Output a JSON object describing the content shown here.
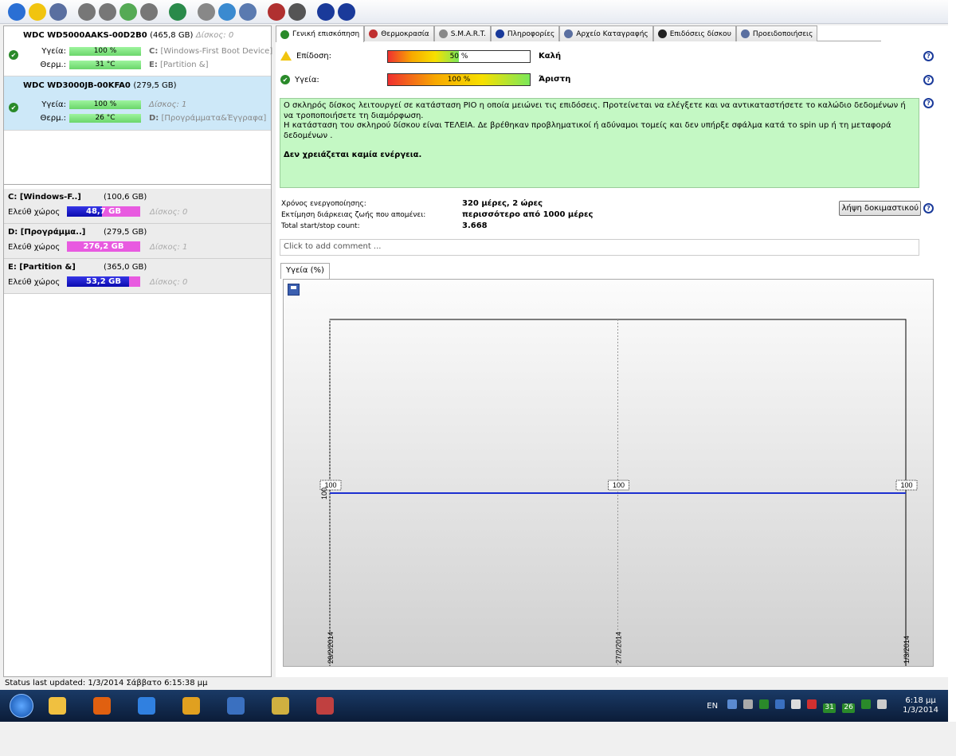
{
  "toolbar": {
    "icons": [
      "refresh-icon",
      "warning-icon",
      "window-icon",
      "disk-icon",
      "disk-icon",
      "disk-icon",
      "disk-icon",
      "globe-icon",
      "document-icon",
      "sync-icon",
      "network-icon",
      "chart-icon",
      "settings-icon",
      "help-icon",
      "info-icon"
    ],
    "icon_colors": [
      "#2a6fd4",
      "#f1c40f",
      "#5a6fa0",
      "#777777",
      "#777777",
      "#55aa55",
      "#777777",
      "#2a8a4a",
      "#888888",
      "#3a8ad0",
      "#5a7ab0",
      "#b03030",
      "#555555",
      "#1a3a9a",
      "#1a3a9a"
    ]
  },
  "disks": [
    {
      "name": "WDC WD5000AAKS-00D2B0",
      "capacity": "(465,8 GB)",
      "index_label": "Δίσκος: 0",
      "health_label": "Υγεία:",
      "health_value": "100 %",
      "health_level": 100,
      "temp_label": "Θερμ.:",
      "temp_value": "31 °C",
      "partitions": [
        {
          "letter": "C:",
          "name": "[Windows-First Boot Device]"
        },
        {
          "letter": "E:",
          "name": "[Partition &]"
        }
      ]
    },
    {
      "name": "WDC WD3000JB-00KFA0",
      "capacity": "(279,5 GB)",
      "health_label": "Υγεία:",
      "health_value": "100 %",
      "health_level": 100,
      "temp_label": "Θερμ.:",
      "temp_value": "26 °C",
      "index_label": "Δίσκος: 1",
      "partitions": [
        {
          "letter": "D:",
          "name": "[Προγράμματα&Έγγραφα]"
        }
      ]
    }
  ],
  "volumes": [
    {
      "name": "C: [Windows-F..]",
      "size": "(100,6 GB)",
      "free_label": "Ελεύθ χώρος",
      "free": "48,7 GB",
      "free_fraction": 0.48,
      "disk": "Δίσκος: 0"
    },
    {
      "name": "D: [Προγράμμα..]",
      "size": "(279,5 GB)",
      "free_label": "Ελεύθ χώρος",
      "free": "276,2 GB",
      "free_fraction": 0.0,
      "disk": "Δίσκος: 1"
    },
    {
      "name": "E: [Partition &]",
      "size": "(365,0 GB)",
      "free_label": "Ελεύθ χώρος",
      "free": "53,2 GB",
      "free_fraction": 0.85,
      "disk": "Δίσκος: 0"
    }
  ],
  "tabs": [
    {
      "label": "Γενική επισκόπηση",
      "icon": "check-icon",
      "color": "#2a8a2a",
      "active": true
    },
    {
      "label": "Θερμοκρασία",
      "icon": "thermometer-icon",
      "color": "#c03030"
    },
    {
      "label": "S.M.A.R.T.",
      "icon": "disk-icon",
      "color": "#888888"
    },
    {
      "label": "Πληροφορίες",
      "icon": "info-icon",
      "color": "#1a3a9a"
    },
    {
      "label": "Αρχείο Καταγραφής",
      "icon": "document-icon",
      "color": "#5a6fa0"
    },
    {
      "label": "Επιδόσεις δίσκου",
      "icon": "gauge-icon",
      "color": "#222222"
    },
    {
      "label": "Προειδοποιήσεις",
      "icon": "alert-doc-icon",
      "color": "#5a6fa0"
    }
  ],
  "overview": {
    "performance_label": "Επίδοση:",
    "performance_value": "50 %",
    "performance_level": 50,
    "performance_rating": "Καλή",
    "health_label": "Υγεία:",
    "health_value": "100 %",
    "health_level": 100,
    "health_rating": "Άριστη",
    "message_lines": [
      "Ο σκληρός δίσκος λειτουργεί σε κατάσταση PIO η οποία μειώνει τις επιδόσεις. Προτείνεται να ελέγξετε και να αντικαταστήσετε το καλώδιο δεδομένων ή να τροποποιήσετε τη διαμόρφωση.",
      "Η κατάσταση του σκληρού δίσκου είναι ΤΕΛΕΙΑ. Δε βρέθηκαν προβληματικοί ή αδύναμοι τομείς και δεν υπήρξε σφάλμα κατά το spin up ή τη μεταφορά δεδομένων ."
    ],
    "action_text": "Δεν χρειάζεται καμία ενέργεια.",
    "power_on_label": "Χρόνος ενεργοποίησης:",
    "power_on_value": "320 μέρες, 2 ώρες",
    "life_label": "Εκτίμηση διάρκειας ζωής που απομένει:",
    "life_value": "περισσότερο από 1000 μέρες",
    "startstop_label": "Total start/stop count:",
    "startstop_value": "3.668",
    "test_button": "λήψη δοκιμαστικού",
    "comment_placeholder": "Click to add comment ..."
  },
  "chart_tab": "Υγεία (%)",
  "chart_data": {
    "type": "line",
    "x": [
      "26/2/2014",
      "27/2/2014",
      "1/3/2014"
    ],
    "series": [
      {
        "values": [
          100,
          100,
          100
        ],
        "color": "#1c2fd0"
      }
    ],
    "point_labels": [
      "100",
      "100",
      "100"
    ],
    "y_tick": "100",
    "grid": "vertical dotted"
  },
  "status": "Status last updated: 1/3/2014 Σάββατο 6:15:38 μμ",
  "taskbar": {
    "apps": [
      "folder-icon",
      "media-player-icon",
      "internet-explorer-icon",
      "chrome-icon",
      "control-panel-icon",
      "league-icon",
      "hdsentinel-icon"
    ],
    "app_colors": [
      "#f0c040",
      "#e06010",
      "#3080e0",
      "#e0a020",
      "#3a70c0",
      "#d0b040",
      "#c04040"
    ],
    "lang": "EN",
    "tray_icons": [
      "network-icon",
      "display-icon",
      "check-icon",
      "vpn-icon",
      "flag-icon",
      "volume-icon",
      "temp-31-icon",
      "temp-26-icon",
      "gpu-icon",
      "speaker-icon"
    ],
    "tray_texts": [
      "31",
      "26"
    ],
    "time": "6:18 μμ",
    "date": "1/3/2014"
  }
}
